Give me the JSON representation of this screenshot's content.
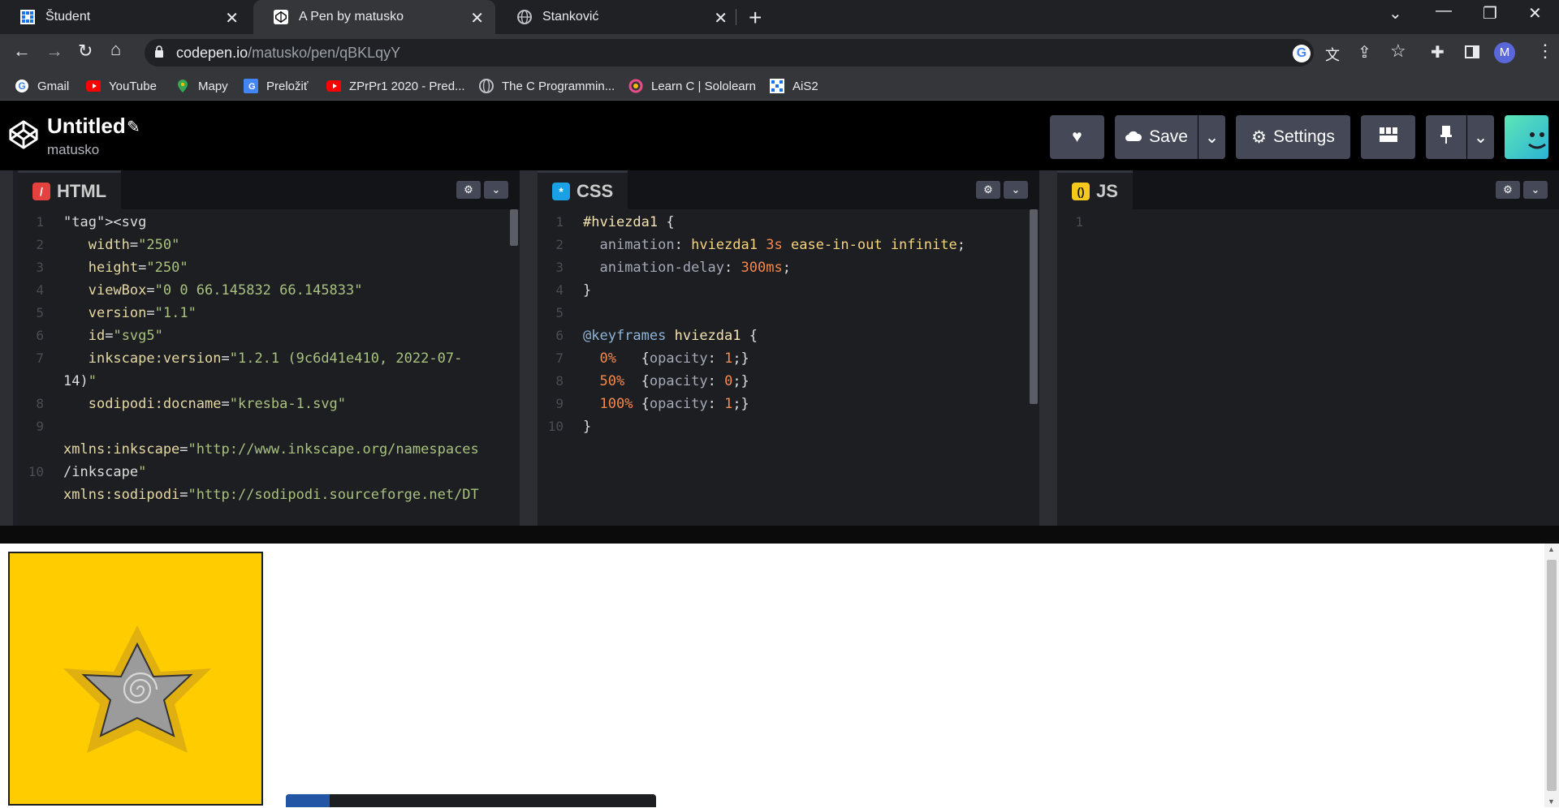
{
  "browser": {
    "tabs": [
      {
        "label": "Študent",
        "active": false,
        "icon": "ais-icon"
      },
      {
        "label": "A Pen by matusko",
        "active": true,
        "icon": "codepen-icon"
      },
      {
        "label": "Stanković",
        "active": false,
        "icon": "globe-icon"
      }
    ],
    "url_host": "codepen.io",
    "url_path": "/matusko/pen/qBKLqyY",
    "profile_initial": "M",
    "bookmarks": [
      {
        "label": "Gmail",
        "icon": "google-icon"
      },
      {
        "label": "YouTube",
        "icon": "youtube-icon"
      },
      {
        "label": "Mapy",
        "icon": "maps-icon"
      },
      {
        "label": "Preložiť",
        "icon": "translate-icon"
      },
      {
        "label": "ZPrPr1 2020 - Pred...",
        "icon": "youtube-icon"
      },
      {
        "label": "The C Programmin...",
        "icon": "globe-icon"
      },
      {
        "label": "Learn C | Sololearn",
        "icon": "sololearn-icon"
      },
      {
        "label": "AiS2",
        "icon": "ais-icon"
      }
    ]
  },
  "codepen": {
    "title": "Untitled",
    "owner": "matusko",
    "save_label": "Save",
    "settings_label": "Settings"
  },
  "editors": {
    "html": {
      "label": "HTML"
    },
    "css": {
      "label": "CSS"
    },
    "js": {
      "label": "JS"
    }
  },
  "html_code": {
    "line_numbers": [
      "1",
      "2",
      "3",
      "4",
      "5",
      "6",
      "7",
      "",
      "8",
      "9",
      "",
      "10",
      ""
    ],
    "lines": [
      "<svg",
      "   width=\"250\"",
      "   height=\"250\"",
      "   viewBox=\"0 0 66.145832 66.145833\"",
      "   version=\"1.1\"",
      "   id=\"svg5\"",
      "   inkscape:version=\"1.2.1 (9c6d41e410, 2022-07-",
      "14)\"",
      "   sodipodi:docname=\"kresba-1.svg\"",
      "",
      "xmlns:inkscape=\"http://www.inkscape.org/namespaces",
      "/inkscape\"",
      "xmlns:sodipodi=\"http://sodipodi.sourceforge.net/DT"
    ]
  },
  "css_code": {
    "line_numbers": [
      "1",
      "2",
      "3",
      "4",
      "5",
      "6",
      "7",
      "8",
      "9",
      "10"
    ],
    "lines": [
      "#hviezda1 {",
      "  animation: hviezda1 3s ease-in-out infinite;",
      "  animation-delay: 300ms;",
      "}",
      "",
      "@keyframes hviezda1 {",
      "  0%   {opacity: 1;}",
      "  50%  {opacity: 0;}",
      "  100% {opacity: 1;}",
      "}"
    ]
  },
  "js_code": {
    "line_numbers": [
      "1"
    ]
  },
  "colors": {
    "preview_bg": "#ffcc00",
    "star_halo": "#e0b010",
    "star_fill": "#9b9b9b"
  }
}
